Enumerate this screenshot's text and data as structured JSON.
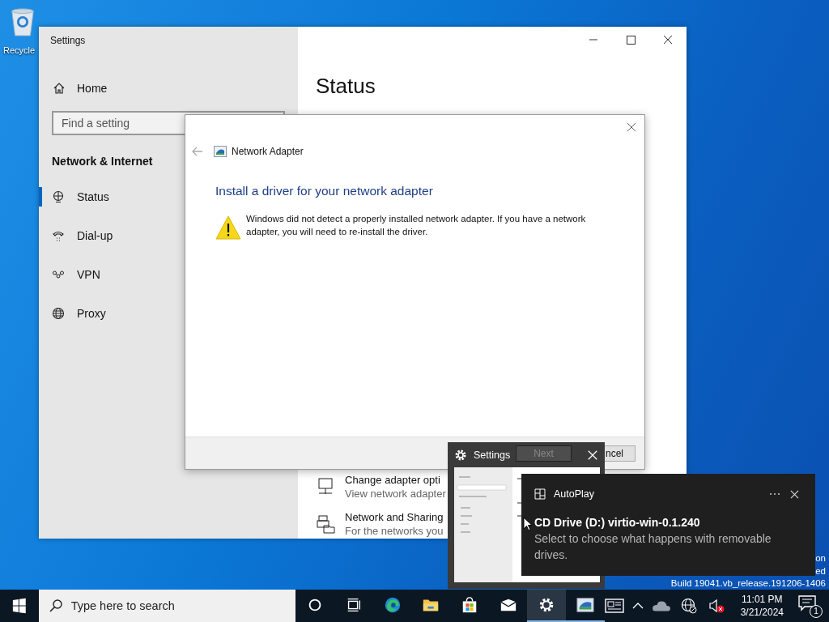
{
  "desktop": {
    "icons": [
      {
        "label": "Recycle"
      }
    ],
    "watermark": [
      "on",
      "ed",
      "Build 19041.vb_release.191206-1406"
    ]
  },
  "settings_window": {
    "title": "Settings",
    "sidebar": {
      "home": "Home",
      "search": {
        "placeholder": "Find a setting"
      },
      "section": "Network & Internet",
      "items": [
        {
          "kind": "status",
          "label": "Status",
          "selected": true
        },
        {
          "kind": "dialup",
          "label": "Dial-up",
          "selected": false
        },
        {
          "kind": "vpn",
          "label": "VPN",
          "selected": false
        },
        {
          "kind": "proxy",
          "label": "Proxy",
          "selected": false
        }
      ]
    },
    "content": {
      "heading": "Status",
      "items": [
        {
          "kind": "adapter",
          "title": "Change adapter opti",
          "subtitle": "View network adapter"
        },
        {
          "kind": "sharing",
          "title": "Network and Sharing",
          "subtitle": "For the networks you"
        }
      ]
    }
  },
  "dialog": {
    "title": "Network Adapter",
    "heading": "Install a driver for your network adapter",
    "message": "Windows did not detect a properly installed network adapter. If you have a network adapter, you will need to re-install the driver.",
    "buttons": [
      {
        "label": "Next",
        "disabled": true
      },
      {
        "label": "ncel",
        "disabled": false
      }
    ]
  },
  "thumbnail": {
    "title": "Settings"
  },
  "toast": {
    "app": "AutoPlay",
    "title": "CD Drive (D:) virtio-win-0.1.240",
    "body": "Select to choose what happens with removable drives."
  },
  "taskbar": {
    "search": {
      "placeholder": "Type here to search"
    },
    "apps": [
      {
        "kind": "cortana",
        "selected": false,
        "running": false
      },
      {
        "kind": "taskview",
        "selected": false,
        "running": false
      },
      {
        "kind": "edge",
        "selected": false,
        "running": false
      },
      {
        "kind": "explorer",
        "selected": false,
        "running": false
      },
      {
        "kind": "store",
        "selected": false,
        "running": false
      },
      {
        "kind": "mail",
        "selected": false,
        "running": false
      },
      {
        "kind": "settings",
        "selected": true,
        "running": true
      },
      {
        "kind": "adapter",
        "selected": false,
        "running": true
      }
    ],
    "time": "11:01 PM",
    "date": "3/21/2024",
    "notifications": "1"
  }
}
